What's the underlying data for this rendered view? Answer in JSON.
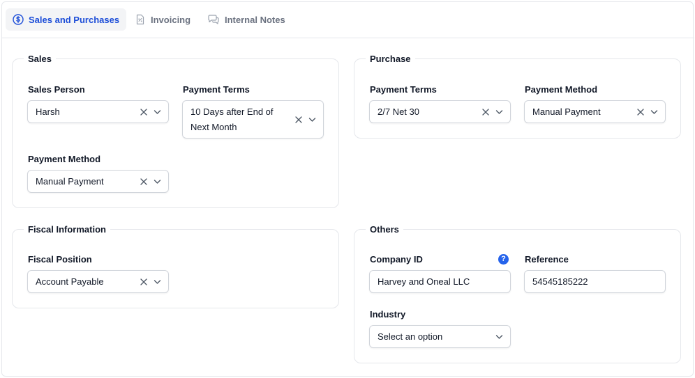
{
  "tabs": [
    {
      "label": "Sales and Purchases",
      "icon": "dollar-circle-icon",
      "active": true
    },
    {
      "label": "Invoicing",
      "icon": "invoice-icon",
      "active": false
    },
    {
      "label": "Internal Notes",
      "icon": "chat-bubbles-icon",
      "active": false
    }
  ],
  "sales": {
    "title": "Sales",
    "sales_person": {
      "label": "Sales Person",
      "value": "Harsh"
    },
    "payment_terms": {
      "label": "Payment Terms",
      "value": "10 Days after End of Next Month"
    },
    "payment_method": {
      "label": "Payment Method",
      "value": "Manual Payment"
    }
  },
  "purchase": {
    "title": "Purchase",
    "payment_terms": {
      "label": "Payment Terms",
      "value": "2/7 Net 30"
    },
    "payment_method": {
      "label": "Payment Method",
      "value": "Manual Payment"
    }
  },
  "fiscal": {
    "title": "Fiscal Information",
    "fiscal_position": {
      "label": "Fiscal Position",
      "value": "Account Payable"
    }
  },
  "others": {
    "title": "Others",
    "company_id": {
      "label": "Company ID",
      "value": "Harvey and Oneal LLC",
      "help": "?"
    },
    "reference": {
      "label": "Reference",
      "value": "54545185222"
    },
    "industry": {
      "label": "Industry",
      "placeholder": "Select an option"
    }
  },
  "colors": {
    "accent": "#1d4ed8",
    "help_badge": "#2563eb",
    "border": "#e5e7eb"
  }
}
